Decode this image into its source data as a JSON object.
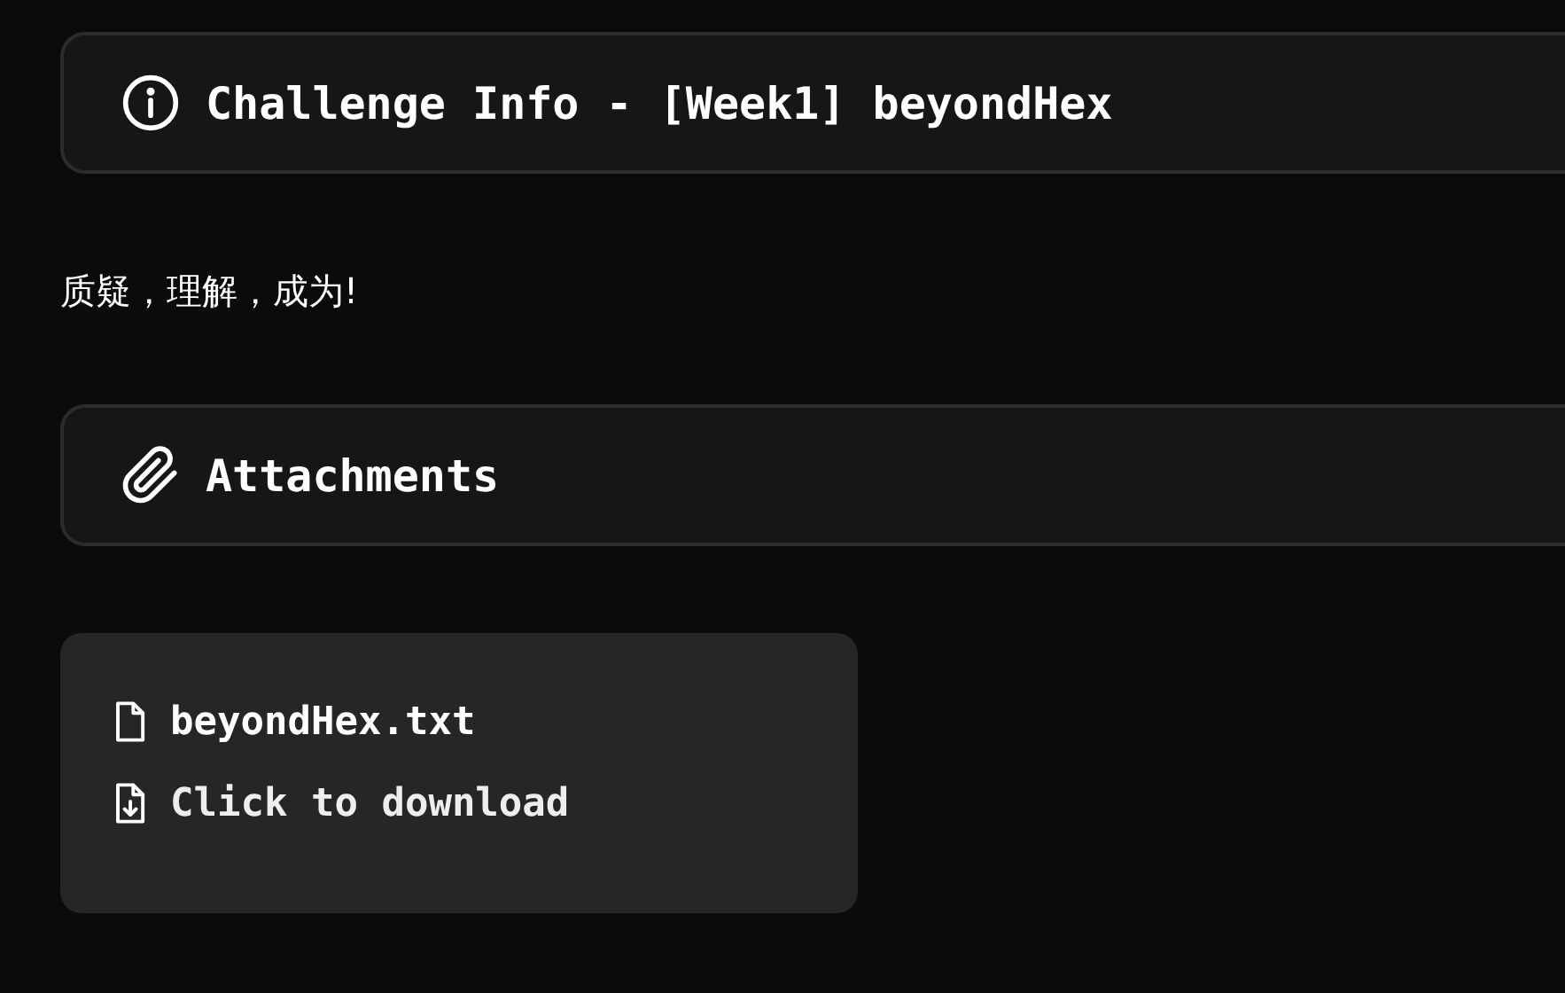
{
  "challenge_header": {
    "title": "Challenge Info - [Week1] beyondHex"
  },
  "description": "质疑，理解，成为!",
  "attachments_header": {
    "title": "Attachments"
  },
  "attachments": [
    {
      "file_name": "beyondHex.txt",
      "action": "Click to download"
    }
  ]
}
